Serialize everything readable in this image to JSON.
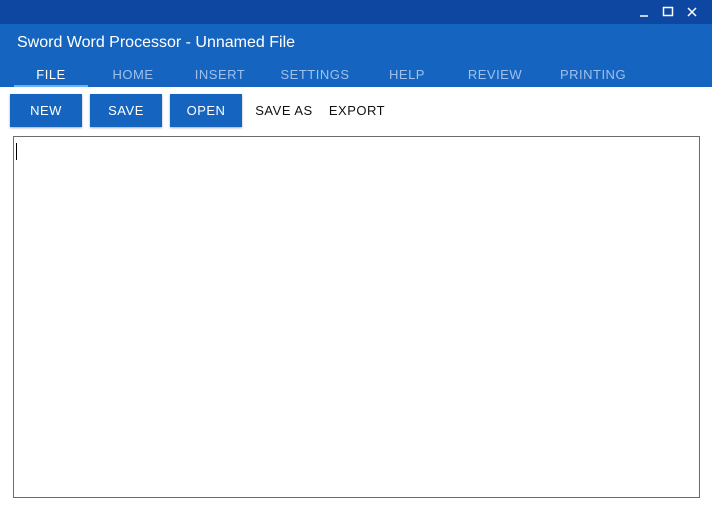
{
  "window": {
    "title": "Sword Word Processor - Unnamed File",
    "controls": {
      "minimize_icon": "minimize-icon",
      "maximize_icon": "maximize-icon",
      "close_icon": "close-icon"
    }
  },
  "tabs": [
    {
      "label": "FILE",
      "active": true
    },
    {
      "label": "HOME",
      "active": false
    },
    {
      "label": "INSERT",
      "active": false
    },
    {
      "label": "SETTINGS",
      "active": false
    },
    {
      "label": "HELP",
      "active": false
    },
    {
      "label": "REVIEW",
      "active": false
    },
    {
      "label": "PRINTING",
      "active": false
    }
  ],
  "toolbar": {
    "new_label": "NEW",
    "save_label": "SAVE",
    "open_label": "OPEN",
    "save_as_label": "SAVE AS",
    "export_label": "EXPORT"
  },
  "editor": {
    "content": ""
  },
  "colors": {
    "titlebar": "#0d47a1",
    "header": "#1565c0",
    "tab_indicator": "#64b5f6",
    "tab_inactive_text": "#9fc0ec",
    "button_fill": "#1565c0"
  }
}
